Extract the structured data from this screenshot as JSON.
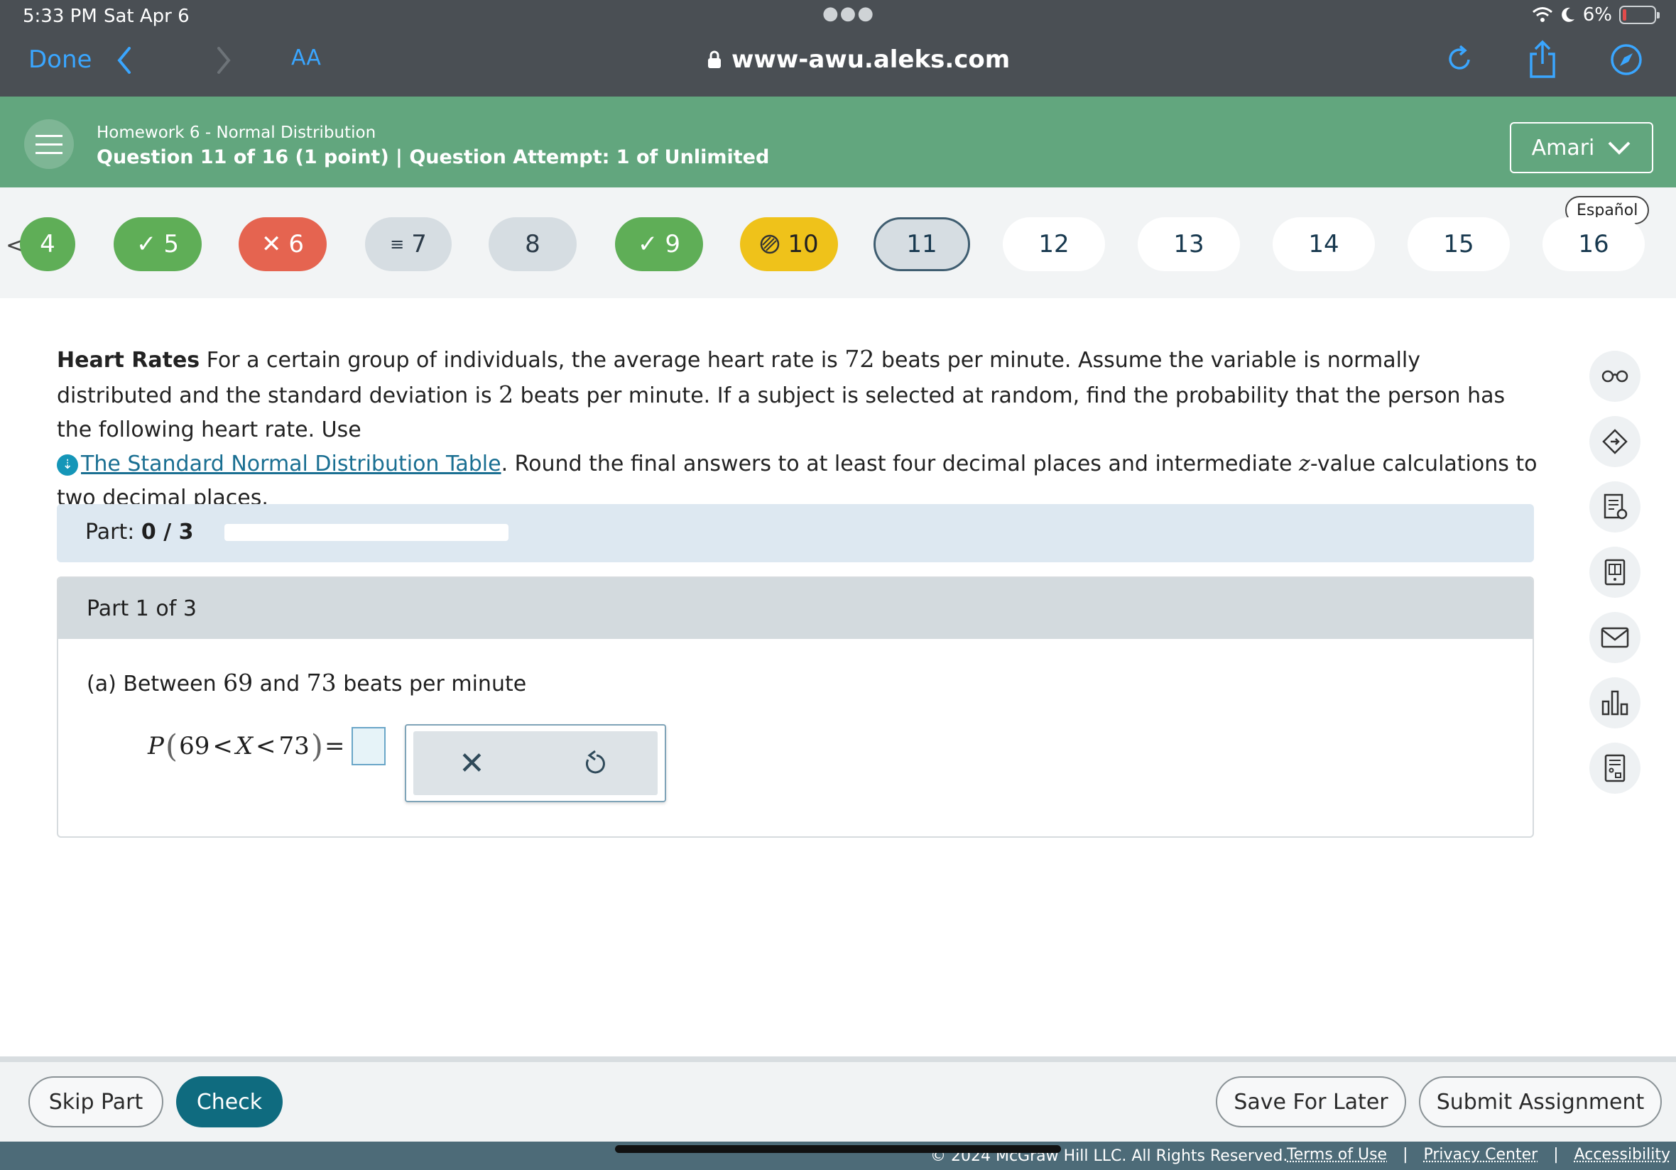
{
  "status_bar": {
    "time": "5:33 PM",
    "date": "Sat Apr 6",
    "battery": "6%"
  },
  "browser": {
    "done": "Done",
    "text_size": "AA",
    "url": "www-awu.aleks.com"
  },
  "header": {
    "assignment": "Homework 6 - Normal Distribution",
    "question_info": "Question 11 of 16 (1 point)  |  Question Attempt: 1 of Unlimited",
    "user": "Amari"
  },
  "question_nav": {
    "language": "Español",
    "items": [
      {
        "num": "4",
        "status": "done"
      },
      {
        "num": "5",
        "status": "done"
      },
      {
        "num": "6",
        "status": "wrong"
      },
      {
        "num": "7",
        "status": "partial"
      },
      {
        "num": "8",
        "status": "unvisited"
      },
      {
        "num": "9",
        "status": "done"
      },
      {
        "num": "10",
        "status": "locked"
      },
      {
        "num": "11",
        "status": "current"
      },
      {
        "num": "12",
        "status": "empty"
      },
      {
        "num": "13",
        "status": "empty"
      },
      {
        "num": "14",
        "status": "empty"
      },
      {
        "num": "15",
        "status": "empty"
      },
      {
        "num": "16",
        "status": "empty"
      }
    ]
  },
  "problem": {
    "title": "Heart Rates",
    "t1": " For a certain group of individuals, the average heart rate is ",
    "mean": "72",
    "t2": " beats per minute. Assume the variable is normally distributed and the standard deviation is ",
    "sd": "2",
    "t3": " beats per minute. If a subject is selected at random, find the probability that the person has the following heart rate. Use ",
    "link": "The Standard Normal Distribution Table",
    "t4": ". Round the final answers to at least four decimal places and intermediate ",
    "zvar": "z",
    "t5": "-value calculations to two decimal places."
  },
  "part_progress": {
    "label": "Part:",
    "value": "0 / 3",
    "fraction": 0
  },
  "part": {
    "header": "Part 1 of 3",
    "q_prefix": "(a) Between ",
    "low": "69",
    "q_mid": " and ",
    "high": "73",
    "q_suffix": " beats per minute",
    "formula_p": "P",
    "formula_low": "69",
    "formula_x": "X",
    "formula_high": "73",
    "answer": ""
  },
  "footer": {
    "skip": "Skip Part",
    "check": "Check",
    "save": "Save For Later",
    "submit": "Submit Assignment",
    "copyright": "© 2024 McGraw Hill LLC. All Rights Reserved.",
    "terms": "Terms of Use",
    "privacy": "Privacy Center",
    "accessibility": "Accessibility"
  },
  "side_tools": [
    "glasses-icon",
    "tag-icon",
    "worksheet-icon",
    "ebook-icon",
    "mail-icon",
    "chart-icon",
    "calculator-icon"
  ],
  "colors": {
    "header_green": "#62a67e",
    "check_teal": "#0f6b7f",
    "correct_green": "#5fae57",
    "wrong_red": "#e56450",
    "locked_yellow": "#efc21a"
  }
}
